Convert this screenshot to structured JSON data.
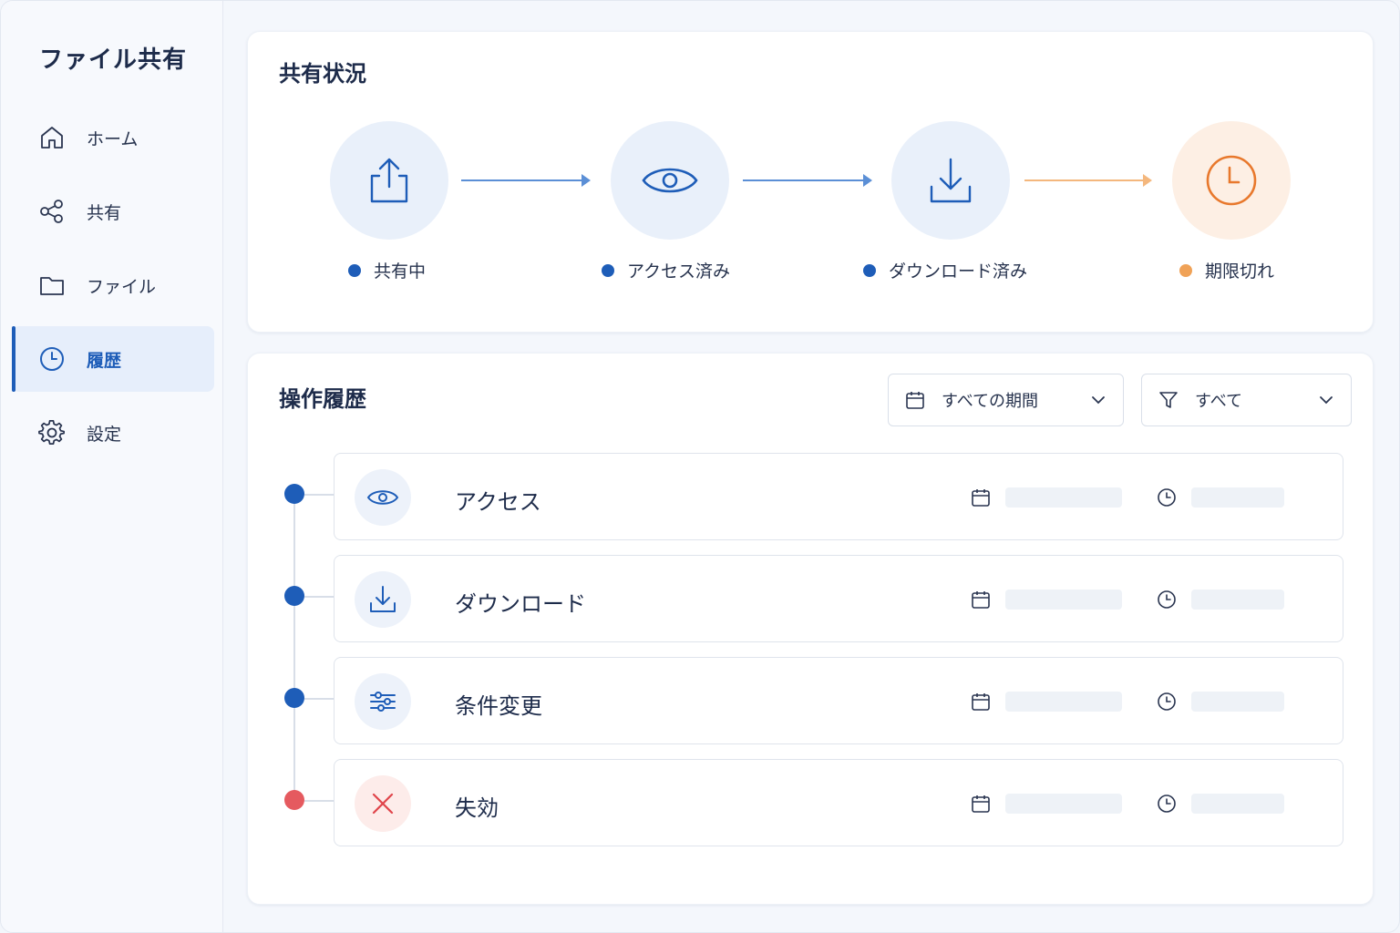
{
  "sidebar": {
    "title": "ファイル共有",
    "items": [
      {
        "label": "ホーム",
        "icon": "home-icon"
      },
      {
        "label": "共有",
        "icon": "share-icon"
      },
      {
        "label": "ファイル",
        "icon": "folder-icon"
      },
      {
        "label": "履歴",
        "icon": "clock-icon",
        "active": true
      },
      {
        "label": "設定",
        "icon": "gear-icon"
      }
    ]
  },
  "status_panel": {
    "title": "共有状況",
    "steps": [
      {
        "label": "共有中",
        "icon": "upload-icon",
        "color": "#1e5db8"
      },
      {
        "label": "アクセス済み",
        "icon": "eye-icon",
        "color": "#1e5db8"
      },
      {
        "label": "ダウンロード済み",
        "icon": "download-icon",
        "color": "#1e5db8"
      },
      {
        "label": "期限切れ",
        "icon": "clock-icon",
        "color": "#f0a257"
      }
    ]
  },
  "history_panel": {
    "title": "操作履歴",
    "filters": {
      "period": "すべての期間",
      "type": "すべて"
    },
    "rows": [
      {
        "label": "アクセス",
        "icon": "eye-icon",
        "status_color": "#1e5db8"
      },
      {
        "label": "ダウンロード",
        "icon": "download-icon",
        "status_color": "#1e5db8"
      },
      {
        "label": "条件変更",
        "icon": "sliders-icon",
        "status_color": "#1e5db8"
      },
      {
        "label": "失効",
        "icon": "close-icon",
        "status_color": "#e55a5f"
      }
    ]
  },
  "colors": {
    "accent": "#1e5db8",
    "warning": "#f0a257",
    "danger": "#e55a5f"
  }
}
